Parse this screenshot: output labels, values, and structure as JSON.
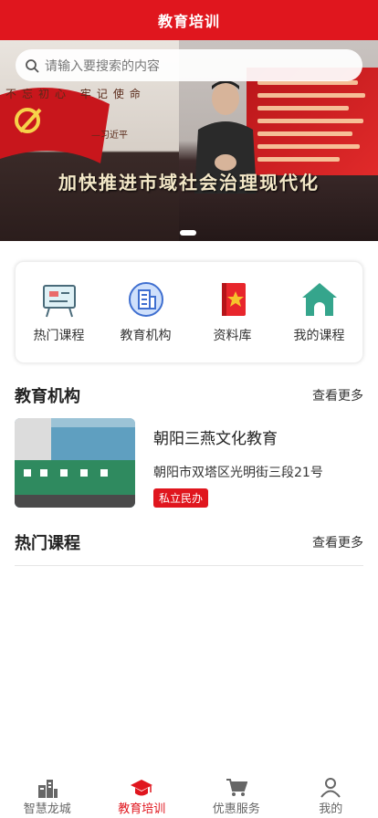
{
  "header": {
    "title": "教育培训"
  },
  "search": {
    "placeholder": "请输入要搜索的内容"
  },
  "banner": {
    "slogan": "加快推进市域社会治理现代化",
    "calligraphy_line1": "不忘初心 牢记使命",
    "calligraphy_line2": "—习近平"
  },
  "quick_nav": [
    {
      "label": "热门课程",
      "icon": "teaching-board-icon"
    },
    {
      "label": "教育机构",
      "icon": "building-badge-icon"
    },
    {
      "label": "资料库",
      "icon": "book-icon"
    },
    {
      "label": "我的课程",
      "icon": "home-icon"
    }
  ],
  "institutions": {
    "title": "教育机构",
    "more": "查看更多",
    "items": [
      {
        "name": "朝阳三燕文化教育",
        "address": "朝阳市双塔区光明街三段21号",
        "tag": "私立民办"
      }
    ]
  },
  "courses": {
    "title": "热门课程",
    "more": "查看更多"
  },
  "tabbar": {
    "items": [
      {
        "label": "智慧龙城",
        "icon": "city-buildings-icon",
        "active": false
      },
      {
        "label": "教育培训",
        "icon": "graduation-cap-icon",
        "active": true
      },
      {
        "label": "优惠服务",
        "icon": "shopping-cart-icon",
        "active": false
      },
      {
        "label": "我的",
        "icon": "user-icon",
        "active": false
      }
    ]
  },
  "colors": {
    "brand": "#e0161e",
    "text": "#222222",
    "muted": "#666666"
  }
}
